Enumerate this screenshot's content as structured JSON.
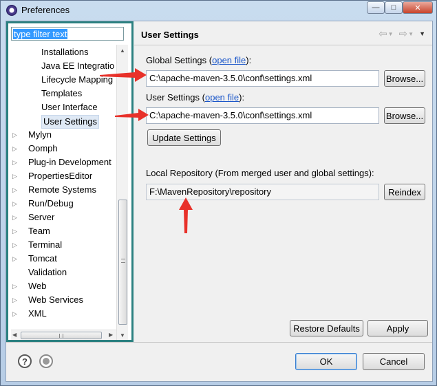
{
  "window": {
    "title": "Preferences"
  },
  "filter": {
    "text": "type filter text"
  },
  "tree": {
    "items": [
      {
        "label": "Installations",
        "level": 1,
        "expandable": false,
        "selected": false
      },
      {
        "label": "Java EE Integratio",
        "level": 1,
        "expandable": false,
        "selected": false
      },
      {
        "label": "Lifecycle Mapping",
        "level": 1,
        "expandable": false,
        "selected": false
      },
      {
        "label": "Templates",
        "level": 1,
        "expandable": false,
        "selected": false
      },
      {
        "label": "User Interface",
        "level": 1,
        "expandable": false,
        "selected": false
      },
      {
        "label": "User Settings",
        "level": 1,
        "expandable": false,
        "selected": true
      },
      {
        "label": "Mylyn",
        "level": 0,
        "expandable": true,
        "selected": false
      },
      {
        "label": "Oomph",
        "level": 0,
        "expandable": true,
        "selected": false
      },
      {
        "label": "Plug-in Development",
        "level": 0,
        "expandable": true,
        "selected": false
      },
      {
        "label": "PropertiesEditor",
        "level": 0,
        "expandable": true,
        "selected": false
      },
      {
        "label": "Remote Systems",
        "level": 0,
        "expandable": true,
        "selected": false
      },
      {
        "label": "Run/Debug",
        "level": 0,
        "expandable": true,
        "selected": false
      },
      {
        "label": "Server",
        "level": 0,
        "expandable": true,
        "selected": false
      },
      {
        "label": "Team",
        "level": 0,
        "expandable": true,
        "selected": false
      },
      {
        "label": "Terminal",
        "level": 0,
        "expandable": true,
        "selected": false
      },
      {
        "label": "Tomcat",
        "level": 0,
        "expandable": true,
        "selected": false
      },
      {
        "label": "Validation",
        "level": 0,
        "expandable": false,
        "selected": false
      },
      {
        "label": "Web",
        "level": 0,
        "expandable": true,
        "selected": false
      },
      {
        "label": "Web Services",
        "level": 0,
        "expandable": true,
        "selected": false
      },
      {
        "label": "XML",
        "level": 0,
        "expandable": true,
        "selected": false
      }
    ]
  },
  "page": {
    "title": "User Settings",
    "global_label": "Global Settings (",
    "global_link": "open file",
    "global_suffix": "):",
    "global_value": "C:\\apache-maven-3.5.0\\conf\\settings.xml",
    "user_label": "User Settings (",
    "user_link": "open file",
    "user_suffix": "):",
    "user_value": "C:\\apache-maven-3.5.0\\conf\\settings.xml",
    "browse_label": "Browse...",
    "update_label": "Update Settings",
    "local_repo_label": "Local Repository (From merged user and global settings):",
    "local_repo_value": "F:\\MavenRepository\\repository",
    "reindex_label": "Reindex",
    "restore_label": "Restore Defaults",
    "apply_label": "Apply"
  },
  "footer": {
    "ok_label": "OK",
    "cancel_label": "Cancel",
    "help_glyph": "?"
  },
  "icons": {
    "window_controls": [
      "minimize-icon",
      "maximize-icon",
      "close-icon"
    ],
    "nav": [
      "back-icon",
      "back-menu-icon",
      "forward-icon",
      "forward-menu-icon",
      "view-menu-icon"
    ],
    "annotation_color": "#e8312a"
  }
}
